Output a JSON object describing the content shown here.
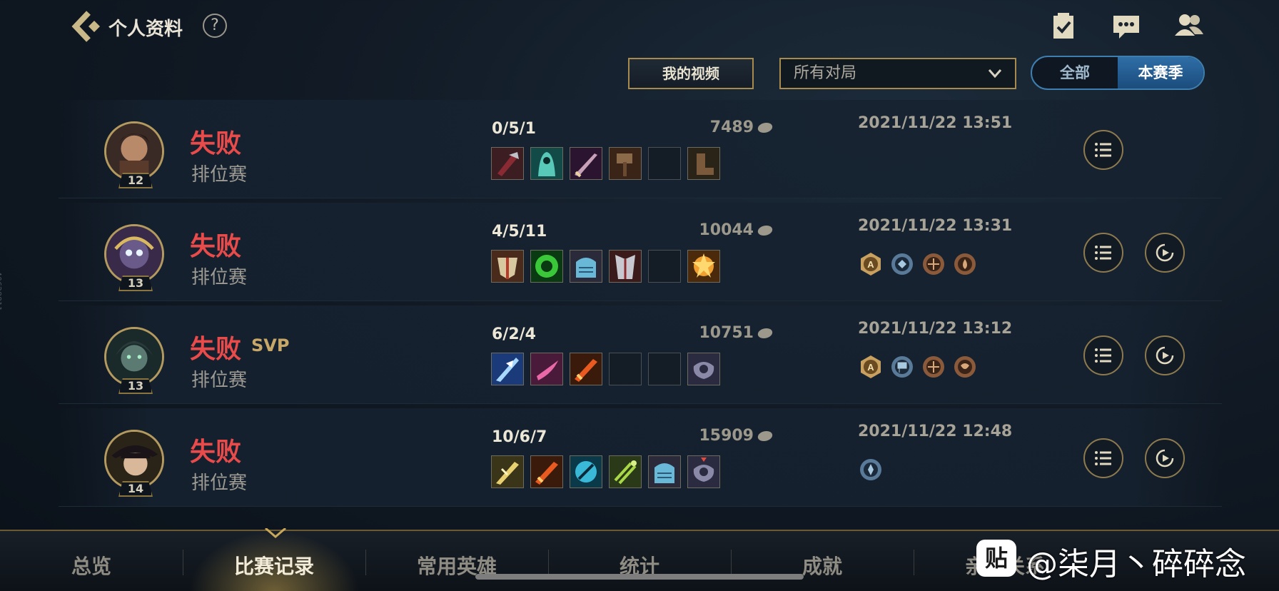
{
  "header": {
    "title": "个人资料",
    "help_label": "?",
    "icons": [
      "back-icon",
      "task-check-icon",
      "chat-icon",
      "friends-icon"
    ]
  },
  "controls": {
    "video_label": "我的视频",
    "filter_value": "所有对局",
    "season_options": [
      "全部",
      "本赛季"
    ],
    "season_selected": "本赛季"
  },
  "matches": [
    {
      "level": "12",
      "result": "失败",
      "svp": "",
      "mode": "排位赛",
      "kda": "0/5/1",
      "gold": "7489",
      "time": "2021/11/22 13:51",
      "has_replay": false,
      "badges": []
    },
    {
      "level": "13",
      "result": "失败",
      "svp": "",
      "mode": "排位赛",
      "kda": "4/5/11",
      "gold": "10044",
      "time": "2021/11/22 13:31",
      "has_replay": true,
      "badges": [
        "A",
        "blue",
        "bronze",
        "bronze"
      ]
    },
    {
      "level": "13",
      "result": "失败",
      "svp": "SVP",
      "mode": "排位赛",
      "kda": "6/2/4",
      "gold": "10751",
      "time": "2021/11/22 13:12",
      "has_replay": true,
      "badges": [
        "A",
        "blue",
        "bronze",
        "bronze"
      ]
    },
    {
      "level": "14",
      "result": "失败",
      "svp": "",
      "mode": "排位赛",
      "kda": "10/6/7",
      "gold": "15909",
      "time": "2021/11/22 12:48",
      "has_replay": true,
      "badges": [
        "blue"
      ]
    }
  ],
  "bottom_nav": {
    "tabs": [
      "总览",
      "比赛记录",
      "常用英雄",
      "统计",
      "成就",
      "亲密关系"
    ],
    "active": "比赛记录"
  },
  "watermark": {
    "logo": "贴",
    "text": "@柒月丶碎碎念"
  },
  "side_code": "40628811",
  "colors": {
    "defeat": "#e94b4b",
    "gold_border": "#a68a4e",
    "season_active": "#2f6ea7"
  }
}
